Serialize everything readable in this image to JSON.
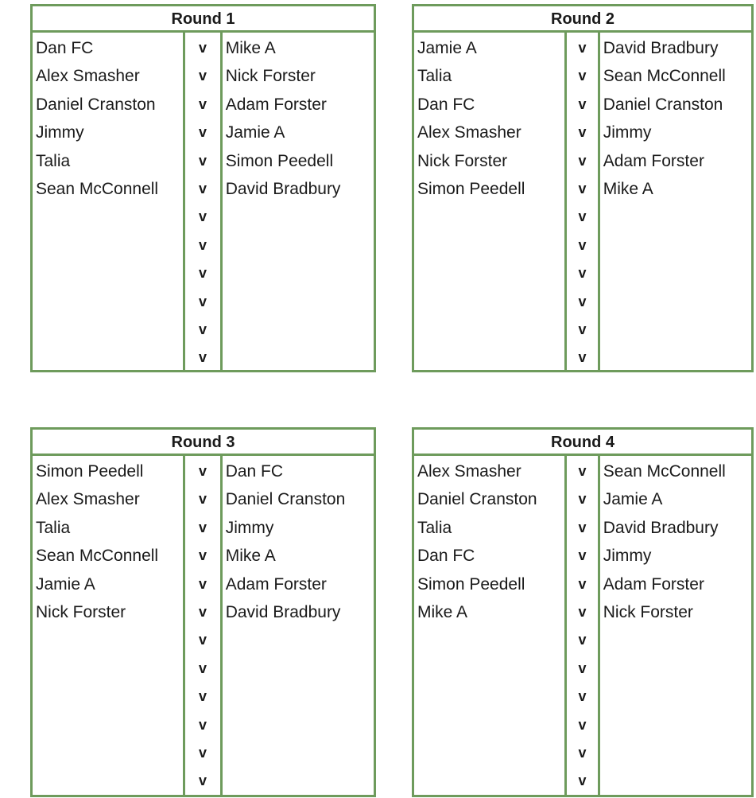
{
  "rounds": [
    {
      "title": "Round 1",
      "fixtures": [
        {
          "home": "Dan FC",
          "vs": "v",
          "away": "Mike A"
        },
        {
          "home": "Alex Smasher",
          "vs": "v",
          "away": "Nick Forster"
        },
        {
          "home": "Daniel Cranston",
          "vs": "v",
          "away": "Adam Forster"
        },
        {
          "home": "Jimmy",
          "vs": "v",
          "away": "Jamie A"
        },
        {
          "home": "Talia",
          "vs": "v",
          "away": "Simon Peedell"
        },
        {
          "home": "Sean McConnell",
          "vs": "v",
          "away": "David Bradbury"
        },
        {
          "home": "",
          "vs": "v",
          "away": ""
        },
        {
          "home": "",
          "vs": "v",
          "away": ""
        },
        {
          "home": "",
          "vs": "v",
          "away": ""
        },
        {
          "home": "",
          "vs": "v",
          "away": ""
        },
        {
          "home": "",
          "vs": "v",
          "away": ""
        },
        {
          "home": "",
          "vs": "v",
          "away": ""
        }
      ]
    },
    {
      "title": "Round 2",
      "fixtures": [
        {
          "home": "Jamie A",
          "vs": "v",
          "away": "David Bradbury"
        },
        {
          "home": "Talia",
          "vs": "v",
          "away": "Sean McConnell"
        },
        {
          "home": "Dan FC",
          "vs": "v",
          "away": "Daniel Cranston"
        },
        {
          "home": "Alex Smasher",
          "vs": "v",
          "away": "Jimmy"
        },
        {
          "home": "Nick Forster",
          "vs": "v",
          "away": "Adam Forster"
        },
        {
          "home": "Simon Peedell",
          "vs": "v",
          "away": "Mike A"
        },
        {
          "home": "",
          "vs": "v",
          "away": ""
        },
        {
          "home": "",
          "vs": "v",
          "away": ""
        },
        {
          "home": "",
          "vs": "v",
          "away": ""
        },
        {
          "home": "",
          "vs": "v",
          "away": ""
        },
        {
          "home": "",
          "vs": "v",
          "away": ""
        },
        {
          "home": "",
          "vs": "v",
          "away": ""
        }
      ]
    },
    {
      "title": "Round 3",
      "fixtures": [
        {
          "home": "Simon Peedell",
          "vs": "v",
          "away": "Dan FC"
        },
        {
          "home": "Alex Smasher",
          "vs": "v",
          "away": "Daniel Cranston"
        },
        {
          "home": "Talia",
          "vs": "v",
          "away": "Jimmy"
        },
        {
          "home": "Sean McConnell",
          "vs": "v",
          "away": "Mike A"
        },
        {
          "home": "Jamie A",
          "vs": "v",
          "away": "Adam Forster"
        },
        {
          "home": "Nick Forster",
          "vs": "v",
          "away": "David Bradbury"
        },
        {
          "home": "",
          "vs": "v",
          "away": ""
        },
        {
          "home": "",
          "vs": "v",
          "away": ""
        },
        {
          "home": "",
          "vs": "v",
          "away": ""
        },
        {
          "home": "",
          "vs": "v",
          "away": ""
        },
        {
          "home": "",
          "vs": "v",
          "away": ""
        },
        {
          "home": "",
          "vs": "v",
          "away": ""
        }
      ]
    },
    {
      "title": "Round 4",
      "fixtures": [
        {
          "home": "Alex Smasher",
          "vs": "v",
          "away": "Sean McConnell"
        },
        {
          "home": "Daniel Cranston",
          "vs": "v",
          "away": "Jamie A"
        },
        {
          "home": "Talia",
          "vs": "v",
          "away": "David Bradbury"
        },
        {
          "home": "Dan FC",
          "vs": "v",
          "away": "Jimmy"
        },
        {
          "home": "Simon Peedell",
          "vs": "v",
          "away": "Adam Forster"
        },
        {
          "home": "Mike A",
          "vs": "v",
          "away": "Nick Forster"
        },
        {
          "home": "",
          "vs": "v",
          "away": ""
        },
        {
          "home": "",
          "vs": "v",
          "away": ""
        },
        {
          "home": "",
          "vs": "v",
          "away": ""
        },
        {
          "home": "",
          "vs": "v",
          "away": ""
        },
        {
          "home": "",
          "vs": "v",
          "away": ""
        },
        {
          "home": "",
          "vs": "v",
          "away": ""
        }
      ]
    }
  ]
}
